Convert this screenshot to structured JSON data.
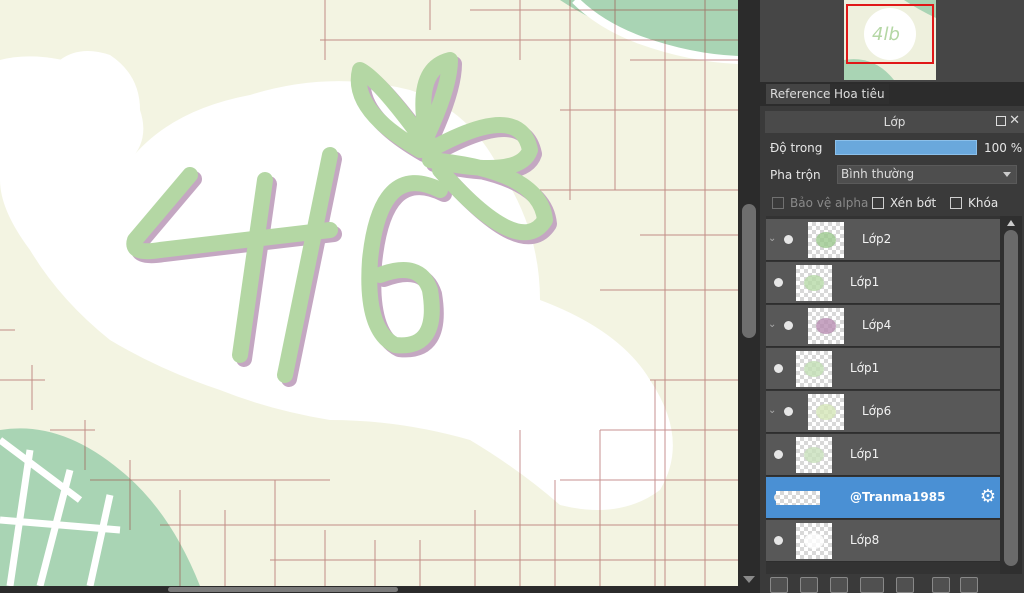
{
  "tabs": {
    "reference": "Reference",
    "navigator": "Hoa tiêu"
  },
  "layer_panel": {
    "title": "Lớp",
    "opacity_label": "Độ trong",
    "opacity_value": "100 %",
    "opacity_fraction": 1.0,
    "blend_label": "Pha trộn",
    "blend_value": "Bình thường",
    "protect_alpha_label": "Bảo vệ alpha",
    "clipping_label": "Xén bớt",
    "lock_label": "Khóa"
  },
  "layers": [
    {
      "name": "Lớp2",
      "clipped": true,
      "thumb_color": "#9cc98e"
    },
    {
      "name": "Lớp1",
      "clipped": false,
      "thumb_color": "#b6d9a8"
    },
    {
      "name": "Lớp4",
      "clipped": true,
      "thumb_color": "#b98fb3"
    },
    {
      "name": "Lớp1",
      "clipped": false,
      "thumb_color": "#c2dfb4"
    },
    {
      "name": "Lớp6",
      "clipped": true,
      "thumb_color": "#d4e6b8"
    },
    {
      "name": "Lớp1",
      "clipped": false,
      "thumb_color": "#c8e0bc"
    },
    {
      "name": "@Tranma1985",
      "clipped": false,
      "active": true,
      "thumb_color": "#ffffff"
    },
    {
      "name": "Lớp8",
      "clipped": false,
      "thumb_color": "#ffffff"
    }
  ],
  "colors": {
    "canvas_bg": "#f3f4e2",
    "accent": "#4a90d4",
    "grid_line": "#9b3a3a",
    "lettering_green": "#b4d7a4",
    "lettering_shadow": "#c4a7c2",
    "leaf_green": "#a9d4b4"
  },
  "icons": [
    "popout-icon",
    "close-icon",
    "eye-icon",
    "gear-icon",
    "new-page-icon",
    "folder-icon",
    "duplicate-icon",
    "merge-icon"
  ]
}
